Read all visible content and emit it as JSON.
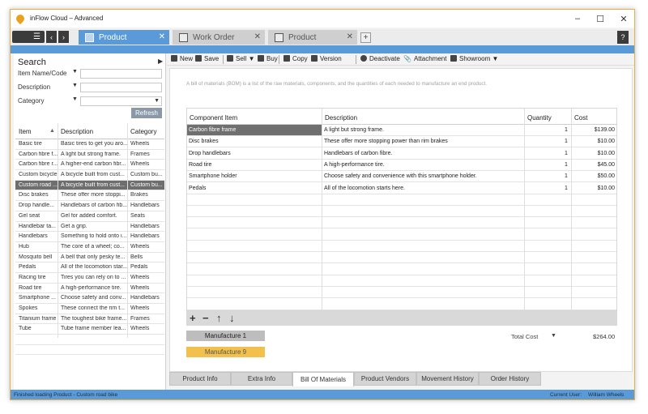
{
  "window": {
    "title": "inFlow Cloud – Advanced"
  },
  "tabs": [
    {
      "label": "Product",
      "active": true
    },
    {
      "label": "Work Order",
      "active": false
    },
    {
      "label": "Product",
      "active": false
    }
  ],
  "help_label": "?",
  "search": {
    "title": "Search",
    "fields": [
      {
        "label": "Item Name/Code",
        "value": ""
      },
      {
        "label": "Description",
        "value": ""
      },
      {
        "label": "Category",
        "value": ""
      }
    ],
    "refresh_label": "Refresh"
  },
  "item_list": {
    "columns": [
      "Item",
      "Description",
      "Category"
    ],
    "rows": [
      [
        "Basic tire",
        "Basic tires to get you aro...",
        "Wheels"
      ],
      [
        "Carbon fibre f...",
        "A light but strong frame.",
        "Frames"
      ],
      [
        "Carbon fibre r...",
        "A higher-end carbon fibr...",
        "Wheels"
      ],
      [
        "Custom bicycle",
        "A bicycle built from cust...",
        "Custom bu..."
      ],
      [
        "Custom road ...",
        "A bicycle built from cust...",
        "Custom bu..."
      ],
      [
        "Disc brakes",
        "These offer more stoppi...",
        "Brakes"
      ],
      [
        "Drop handle...",
        "Handlebars of carbon fib...",
        "Handlebars"
      ],
      [
        "Gel seat",
        "Gel for added comfort.",
        "Seats"
      ],
      [
        "Handlebar ta...",
        "Get a grip.",
        "Handlebars"
      ],
      [
        "Handlebars",
        "Something to hold onto i...",
        "Handlebars"
      ],
      [
        "Hub",
        "The core of a wheel; co...",
        "Wheels"
      ],
      [
        "Mosquito bell",
        "A bell that only pesky te...",
        "Bells"
      ],
      [
        "Pedals",
        "All of the locomotion star...",
        "Pedals"
      ],
      [
        "Racing tire",
        "Tires you can rely on to ...",
        "Wheels"
      ],
      [
        "Road tire",
        "A high-performance tire.",
        "Wheels"
      ],
      [
        "Smartphone ...",
        "Choose safety and conv...",
        "Handlebars"
      ],
      [
        "Spokes",
        "These connect the rim t...",
        "Wheels"
      ],
      [
        "Titanium frame",
        "The toughest bike frame...",
        "Frames"
      ],
      [
        "Tube",
        "Tube frame member lea...",
        "Wheels"
      ]
    ],
    "selected_index": 4
  },
  "toolbar": {
    "new": "New",
    "save": "Save",
    "sell": "Sell",
    "buy": "Buy",
    "copy": "Copy",
    "version": "Version",
    "deactivate": "Deactivate",
    "attachment": "Attachment",
    "showroom": "Showroom"
  },
  "bom": {
    "description": "A bill of materials (BOM) is a list of the raw materials, components, and the quantities of each needed to manufacture an end product.",
    "columns": [
      "Component Item",
      "Description",
      "Quantity",
      "Cost"
    ],
    "rows": [
      [
        "Carbon fibre frame",
        "A light but strong frame.",
        "1",
        "$139.00"
      ],
      [
        "Disc brakes",
        "These offer more stopping power than rim brakes",
        "1",
        "$10.00"
      ],
      [
        "Drop handlebars",
        "Handlebars of carbon fibre.",
        "1",
        "$10.00"
      ],
      [
        "Road tire",
        "A high-performance tire.",
        "1",
        "$45.00"
      ],
      [
        "Smartphone holder",
        "Choose safety and convenience with this smartphone holder.",
        "1",
        "$50.00"
      ],
      [
        "Pedals",
        "All of the locomotion starts here.",
        "1",
        "$10.00"
      ]
    ],
    "grid_controls": {
      "add": "+",
      "remove": "−",
      "up": "↑",
      "down": "↓"
    },
    "manufacture_1": "Manufacture 1",
    "manufacture_2": "Manufacture 9",
    "total_label": "Total Cost",
    "total_value": "$264.00"
  },
  "bottom_tabs": [
    {
      "label": "Product Info",
      "active": false
    },
    {
      "label": "Extra Info",
      "active": false
    },
    {
      "label": "Bill Of Materials",
      "active": true
    },
    {
      "label": "Product Vendors",
      "active": false
    },
    {
      "label": "Movement History",
      "active": false
    },
    {
      "label": "Order History",
      "active": false
    }
  ],
  "status": {
    "message": "Finished loading Product - Custom road bike",
    "user_label": "Current User:",
    "user_name": "William Wheels"
  },
  "colors": {
    "accent": "#5a9ad8",
    "selected_row": "#6e6e6e",
    "manufacture_highlight": "#f2c14d"
  }
}
